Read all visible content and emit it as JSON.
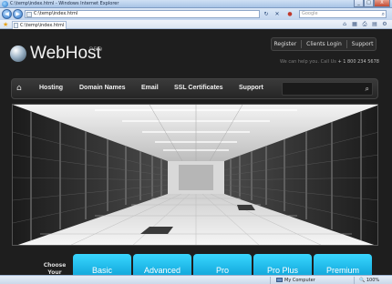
{
  "window": {
    "title": "C:\\temp\\index.html - Windows Internet Explorer",
    "buttons": {
      "minimize": "_",
      "maximize": "□",
      "close": "X"
    }
  },
  "browser": {
    "back_glyph": "◀",
    "forward_glyph": "▶",
    "address": "C:\\temp\\index.html",
    "search_placeholder": "Google",
    "tab_title": "C:\\temp\\index.html",
    "icons": [
      "ie-logo-icon",
      "back-arrow-icon",
      "forward-arrow-icon",
      "refresh-icon",
      "stop-icon",
      "search-icon",
      "favorites-star-icon",
      "home-icon",
      "print-icon",
      "tools-icon"
    ]
  },
  "site": {
    "logo": {
      "name": "WebHost",
      "suffix": "PRO"
    },
    "top_links": [
      "Register",
      "Clients Login",
      "Support"
    ],
    "help_text": "We can help you. Call Us",
    "phone": "+ 1 800 234 5678",
    "nav": [
      "Hosting",
      "Domain Names",
      "Email",
      "SSL Certificates",
      "Support"
    ],
    "plans_heading": "Choose Your Package",
    "plans": [
      "Basic",
      "Advanced",
      "Pro",
      "Pro Plus",
      "Premium"
    ],
    "accent": "#1fbce9"
  },
  "statusbar": {
    "zone": "My Computer",
    "zoom": "100%"
  }
}
